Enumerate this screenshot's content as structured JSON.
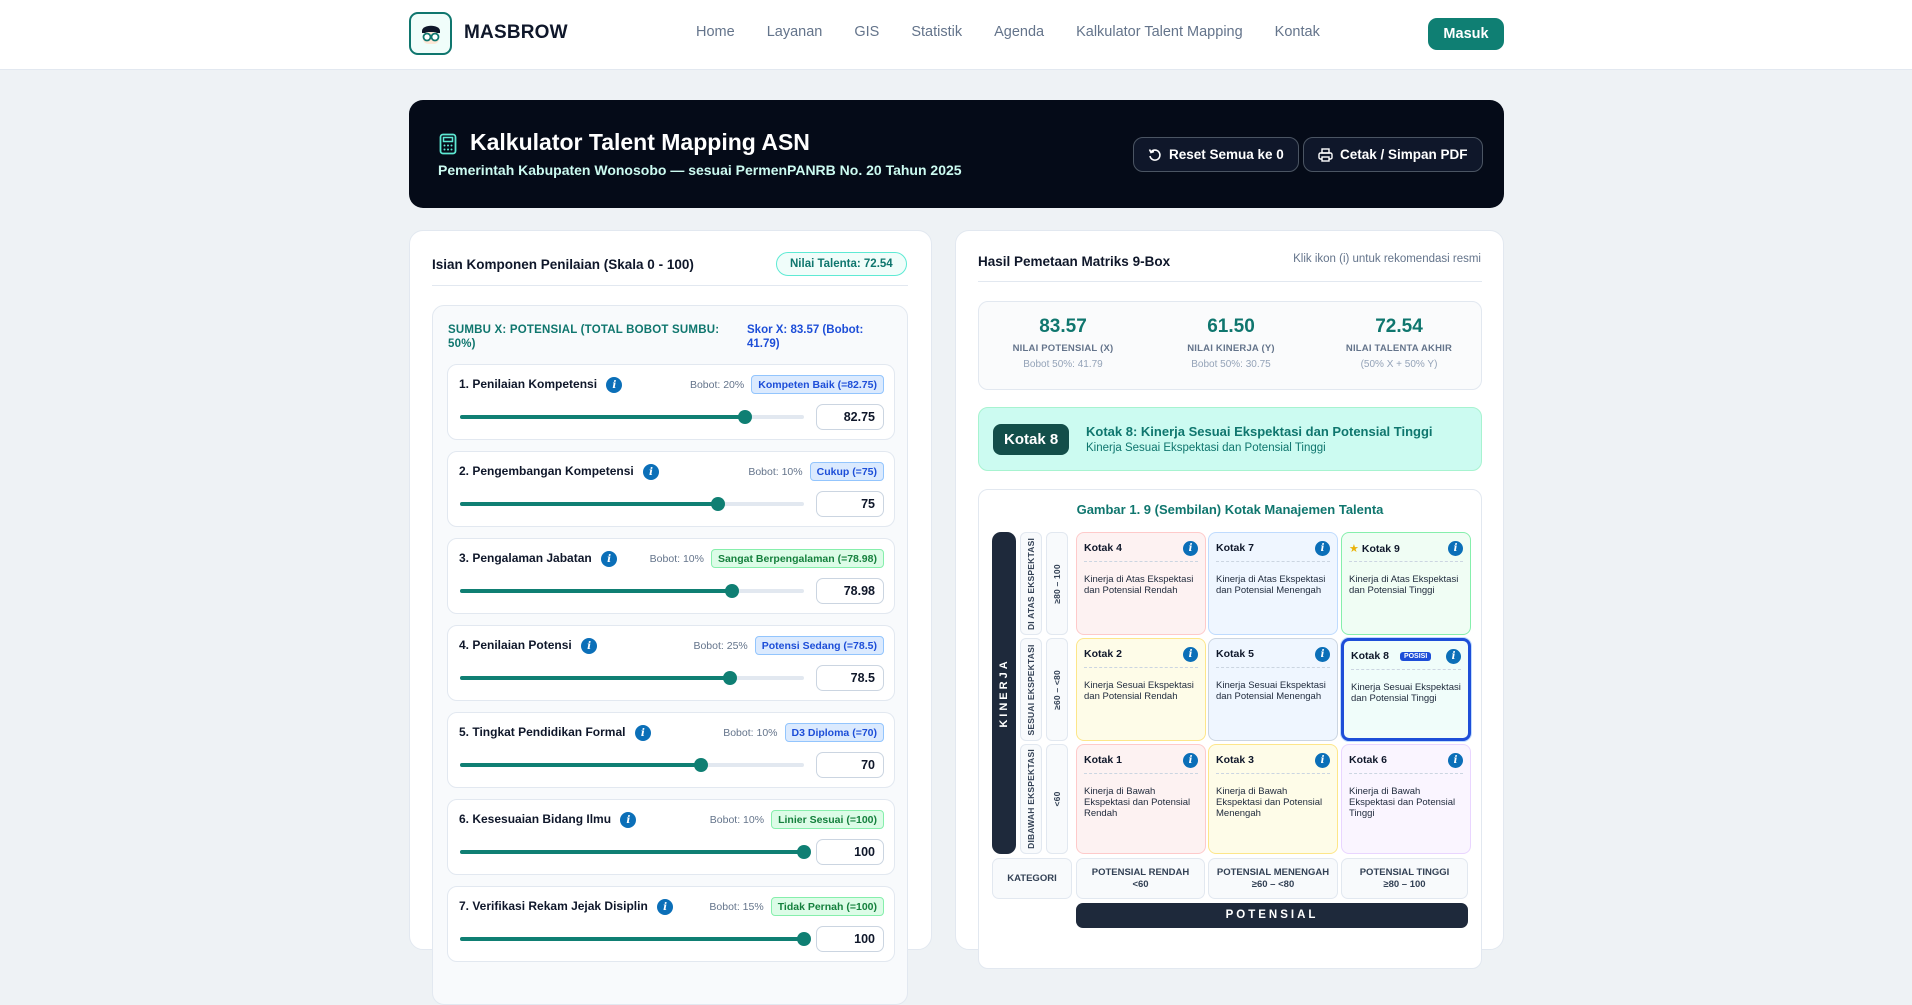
{
  "nav": {
    "brand": "MASBROW",
    "links": [
      "Home",
      "Layanan",
      "GIS",
      "Statistik",
      "Agenda",
      "Kalkulator Talent Mapping",
      "Kontak"
    ],
    "login": "Masuk"
  },
  "hero": {
    "title": "Kalkulator Talent Mapping ASN",
    "subtitle": "Pemerintah Kabupaten Wonosobo — sesuai PermenPANRB No. 20 Tahun 2025",
    "reset": "Reset Semua ke 0",
    "print": "Cetak / Simpan PDF"
  },
  "left": {
    "title": "Isian Komponen Penilaian (Skala 0 - 100)",
    "talenta_pill": "Nilai Talenta: 72.54",
    "x_title": "SUMBU X: POTENSIAL (TOTAL BOBOT SUMBU: 50%)",
    "x_score": "Skor X: 83.57 (Bobot: 41.79)",
    "components": [
      {
        "name": "1. Penilaian Kompetensi",
        "bobot": "Bobot: 20%",
        "badge": "Kompeten Baik (=82.75)",
        "badge_color": "blue",
        "value": "82.75",
        "level": 82.75
      },
      {
        "name": "2. Pengembangan Kompetensi",
        "bobot": "Bobot: 10%",
        "badge": "Cukup (=75)",
        "badge_color": "blue",
        "value": "75",
        "level": 75
      },
      {
        "name": "3. Pengalaman Jabatan",
        "bobot": "Bobot: 10%",
        "badge": "Sangat Berpengalaman (=78.98)",
        "badge_color": "green",
        "value": "78.98",
        "level": 78.98
      },
      {
        "name": "4. Penilaian Potensi",
        "bobot": "Bobot: 25%",
        "badge": "Potensi Sedang (=78.5)",
        "badge_color": "blue",
        "value": "78.5",
        "level": 78.5
      },
      {
        "name": "5. Tingkat Pendidikan Formal",
        "bobot": "Bobot: 10%",
        "badge": "D3 Diploma (=70)",
        "badge_color": "blue",
        "value": "70",
        "level": 70
      },
      {
        "name": "6. Kesesuaian Bidang Ilmu",
        "bobot": "Bobot: 10%",
        "badge": "Linier Sesuai (=100)",
        "badge_color": "green",
        "value": "100",
        "level": 100
      },
      {
        "name": "7. Verifikasi Rekam Jejak Disiplin",
        "bobot": "Bobot: 15%",
        "badge": "Tidak Pernah (=100)",
        "badge_color": "green",
        "value": "100",
        "level": 100
      }
    ]
  },
  "right": {
    "title": "Hasil Pemetaan Matriks 9-Box",
    "hint": "Klik ikon (i) untuk rekomendasi resmi",
    "stats": [
      {
        "value": "83.57",
        "label": "NILAI POTENSIAL (X)",
        "sub": "Bobot 50%: 41.79"
      },
      {
        "value": "61.50",
        "label": "NILAI KINERJA (Y)",
        "sub": "Bobot 50%: 30.75"
      },
      {
        "value": "72.54",
        "label": "NILAI TALENTA AKHIR",
        "sub": "(50% X + 50% Y)"
      }
    ],
    "result": {
      "chip": "Kotak 8",
      "title": "Kotak 8: Kinerja Sesuai Ekspektasi dan Potensial Tinggi",
      "sub": "Kinerja Sesuai Ekspektasi dan Potensial Tinggi"
    },
    "matrix": {
      "title": "Gambar 1. 9 (Sembilan) Kotak Manajemen Talenta",
      "kinerja": "KINERJA",
      "potensial": "POTENSIAL",
      "category": "KATEGORI",
      "row_labels": [
        {
          "name": "DI ATAS EKSPEKTASI",
          "range": "≥80 – 100"
        },
        {
          "name": "SESUAI EKSPEKTASI",
          "range": "≥60 – <80"
        },
        {
          "name": "DIBAWAH EKSPEKTASI",
          "range": "<60"
        }
      ],
      "col_labels": [
        {
          "name": "POTENSIAL RENDAH",
          "range": "<60"
        },
        {
          "name": "POTENSIAL MENENGAH",
          "range": "≥60 – <80"
        },
        {
          "name": "POTENSIAL TINGGI",
          "range": "≥80 – 100"
        }
      ],
      "cells": [
        {
          "name": "Kotak 4",
          "desc": "Kinerja di Atas Ekspektasi dan Potensial Rendah"
        },
        {
          "name": "Kotak 7",
          "desc": "Kinerja di Atas Ekspektasi dan Potensial Menengah"
        },
        {
          "name": "Kotak 9",
          "desc": "Kinerja di Atas Ekspektasi dan Potensial Tinggi"
        },
        {
          "name": "Kotak 2",
          "desc": "Kinerja Sesuai Ekspektasi dan Potensial Rendah"
        },
        {
          "name": "Kotak 5",
          "desc": "Kinerja Sesuai Ekspektasi dan Potensial Menengah"
        },
        {
          "name": "Kotak 8",
          "desc": "Kinerja Sesuai Ekspektasi dan Potensial Tinggi",
          "badge": "POSISI"
        },
        {
          "name": "Kotak 1",
          "desc": "Kinerja di Bawah Ekspektasi dan Potensial Rendah"
        },
        {
          "name": "Kotak 3",
          "desc": "Kinerja di Bawah Ekspektasi dan Potensial Menengah"
        },
        {
          "name": "Kotak 6",
          "desc": "Kinerja di Bawah Ekspektasi dan Potensial Tinggi"
        }
      ],
      "colors": {
        "red": "#fdf2f2",
        "blue": "#eff6ff",
        "green": "#f0fdf4",
        "yellow": "#fefce8",
        "purple": "#faf5ff",
        "active": "#1d4ed8"
      }
    }
  }
}
